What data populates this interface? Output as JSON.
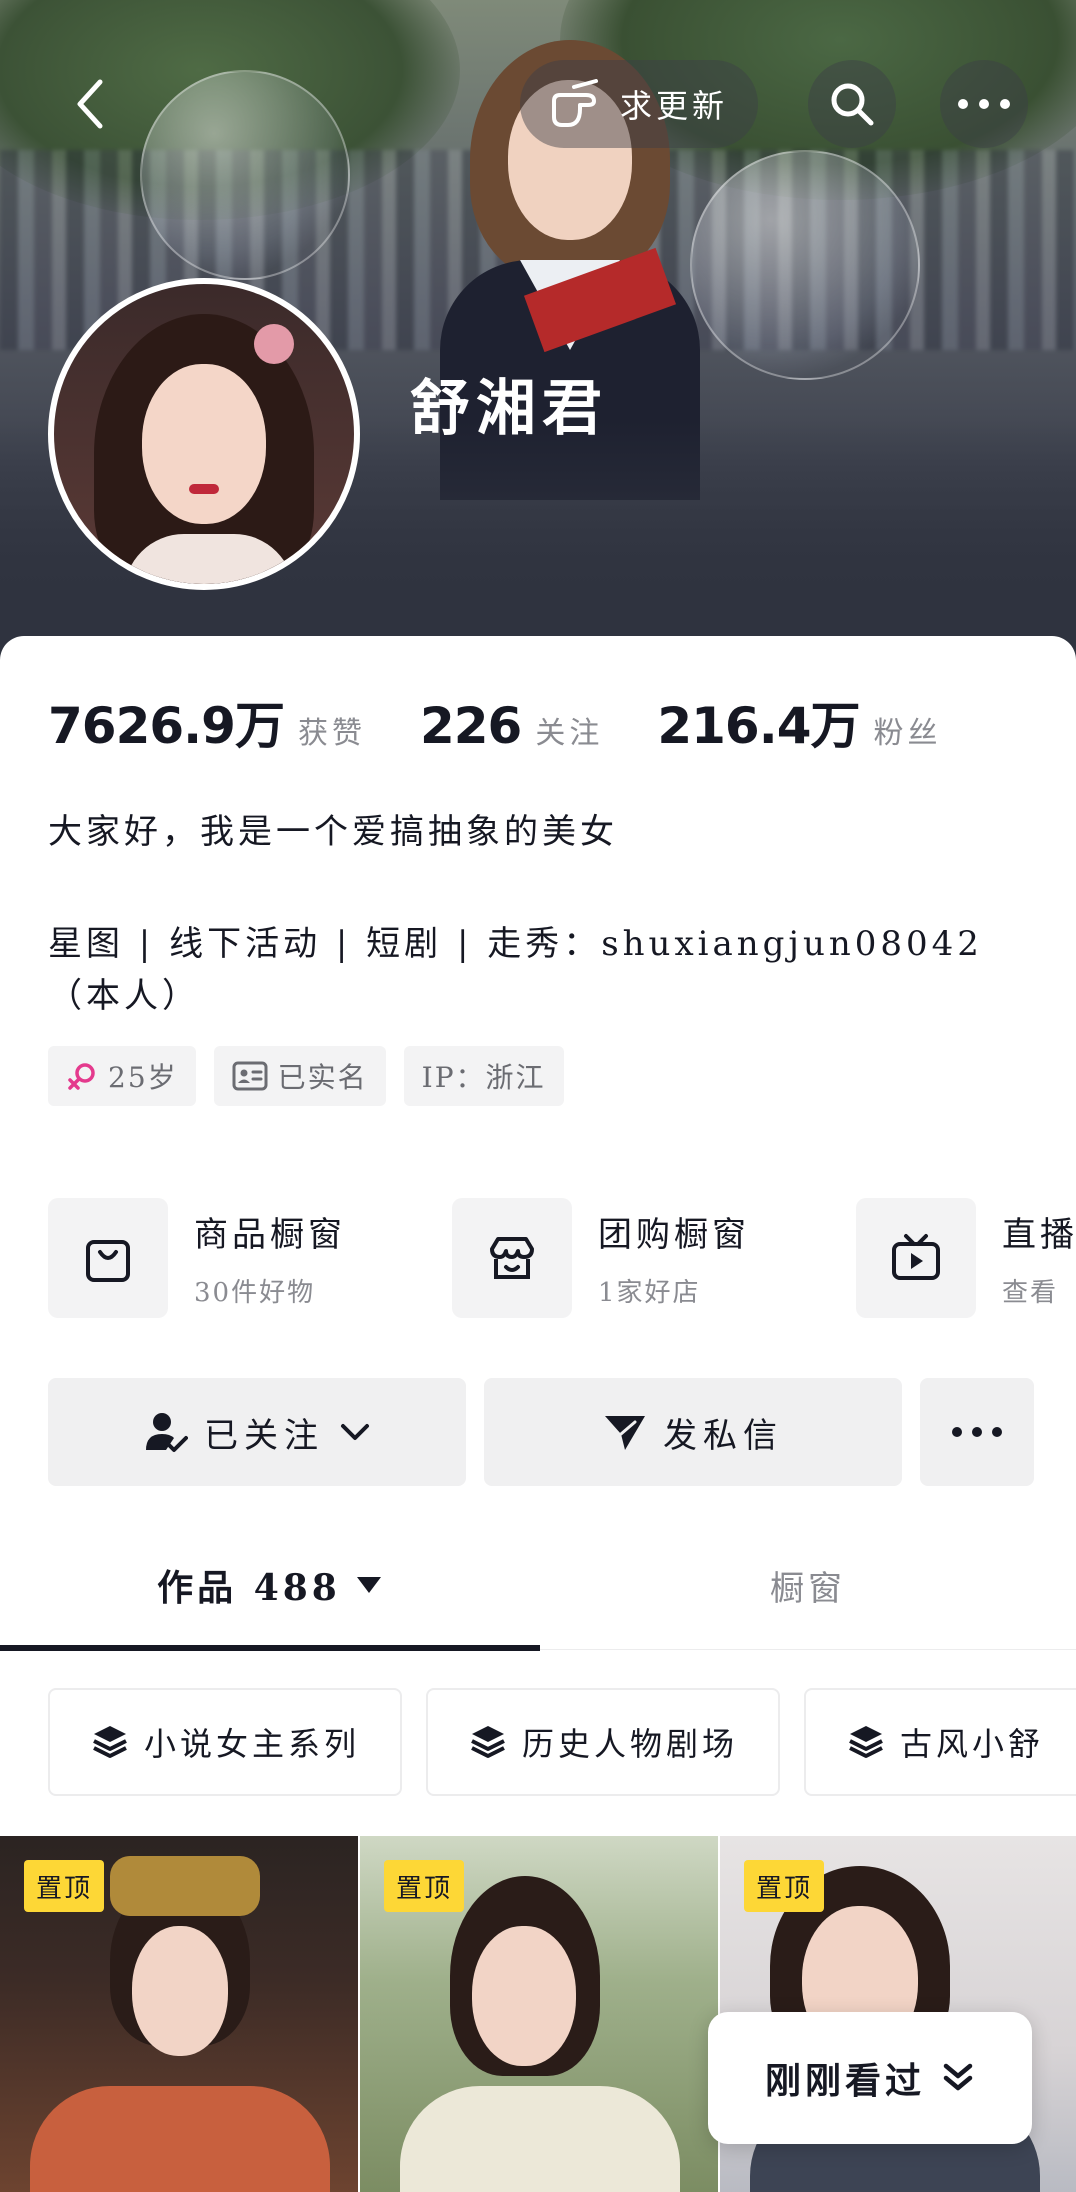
{
  "header": {
    "update_label": "求更新",
    "nickname": "舒湘君"
  },
  "stats": [
    {
      "value": "7626.9万",
      "label": "获赞"
    },
    {
      "value": "226",
      "label": "关注"
    },
    {
      "value": "216.4万",
      "label": "粉丝"
    }
  ],
  "bio": {
    "line1": "大家好，我是一个爱搞抽象的美女",
    "line2": "星图 | 线下活动 | 短剧 | 走秀：shuxiangjun08042（本人）"
  },
  "tags": {
    "age": "25岁",
    "verified": "已实名",
    "ip": "IP：浙江"
  },
  "shops": [
    {
      "title": "商品橱窗",
      "subtitle": "30件好物",
      "icon": "bag-icon"
    },
    {
      "title": "团购橱窗",
      "subtitle": "1家好店",
      "icon": "store-icon"
    },
    {
      "title": "直播",
      "subtitle": "查看",
      "icon": "tv-icon"
    }
  ],
  "actions": {
    "follow": "已关注",
    "message": "发私信"
  },
  "tabs": {
    "works": "作品 488",
    "window": "橱窗"
  },
  "collections": [
    {
      "label": "小说女主系列"
    },
    {
      "label": "历史人物剧场"
    },
    {
      "label": "古风小舒"
    }
  ],
  "videos": [
    {
      "pin": "置顶"
    },
    {
      "pin": "置顶"
    },
    {
      "pin": "置顶"
    }
  ],
  "recent": {
    "label": "刚刚看过"
  },
  "colors": {
    "pin_bg": "#fdd736",
    "text_primary": "#161823",
    "text_secondary": "#8a8b91",
    "female_icon": "#e43a8d"
  }
}
